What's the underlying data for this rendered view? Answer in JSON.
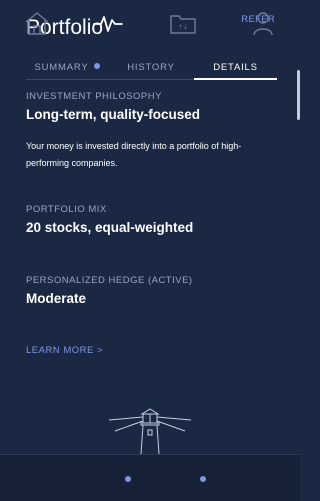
{
  "header": {
    "title": "Portfolio",
    "refer_label": "REFER"
  },
  "tabs": [
    {
      "label": "SUMMARY",
      "has_dot": true,
      "active": false
    },
    {
      "label": "HISTORY",
      "has_dot": false,
      "active": false
    },
    {
      "label": "DETAILS",
      "has_dot": false,
      "active": true
    }
  ],
  "details": {
    "philosophy": {
      "label": "INVESTMENT PHILOSOPHY",
      "value": "Long-term, quality-focused",
      "description": "Your money is invested directly into a portfolio of high-performing companies."
    },
    "mix": {
      "label": "PORTFOLIO MIX",
      "value": "20 stocks, equal-weighted"
    },
    "hedge": {
      "label": "PERSONALIZED HEDGE (ACTIVE)",
      "value": "Moderate"
    },
    "learn_more": "LEARN MORE >"
  },
  "illustration": {
    "icon": "lighthouse-icon"
  },
  "bottom_nav": {
    "items": [
      {
        "icon": "home-icon",
        "active": false,
        "has_dot": false
      },
      {
        "icon": "activity-icon",
        "active": true,
        "has_dot": true
      },
      {
        "icon": "folder-icon",
        "active": false,
        "has_dot": true,
        "badge": "↑↓"
      },
      {
        "icon": "profile-icon",
        "active": false,
        "has_dot": false
      }
    ]
  },
  "colors": {
    "background": "#1a2844",
    "accent": "#7f95e6",
    "muted_text": "#9aa6bd",
    "text": "#ffffff"
  }
}
